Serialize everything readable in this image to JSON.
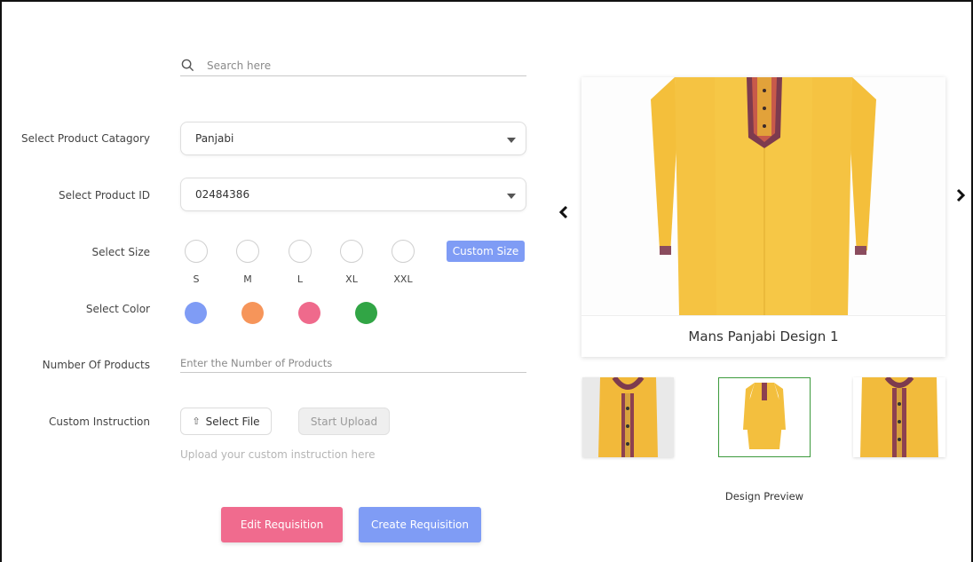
{
  "search": {
    "placeholder": "Search here"
  },
  "form": {
    "category": {
      "label": "Select Product Catagory",
      "value": "Panjabi"
    },
    "product_id": {
      "label": "Select Product ID",
      "value": "02484386"
    },
    "size": {
      "label": "Select Size",
      "options": [
        "S",
        "M",
        "L",
        "XL",
        "XXL"
      ],
      "custom_button": "Custom Size"
    },
    "color": {
      "label": "Select Color",
      "options": [
        "#7f9cf5",
        "#f6955a",
        "#ef6a8c",
        "#31a545"
      ]
    },
    "number": {
      "label": "Number Of Products",
      "placeholder": "Enter the Number of Products"
    },
    "instruction": {
      "label": "Custom Instruction",
      "select_file": "Select File",
      "start_upload": "Start Upload",
      "hint": "Upload your custom instruction here"
    }
  },
  "actions": {
    "edit": "Edit Requisition",
    "create": "Create Requisition"
  },
  "preview": {
    "caption": "Mans Panjabi Design 1",
    "label": "Design Preview",
    "accent": "#f4bf3b"
  }
}
